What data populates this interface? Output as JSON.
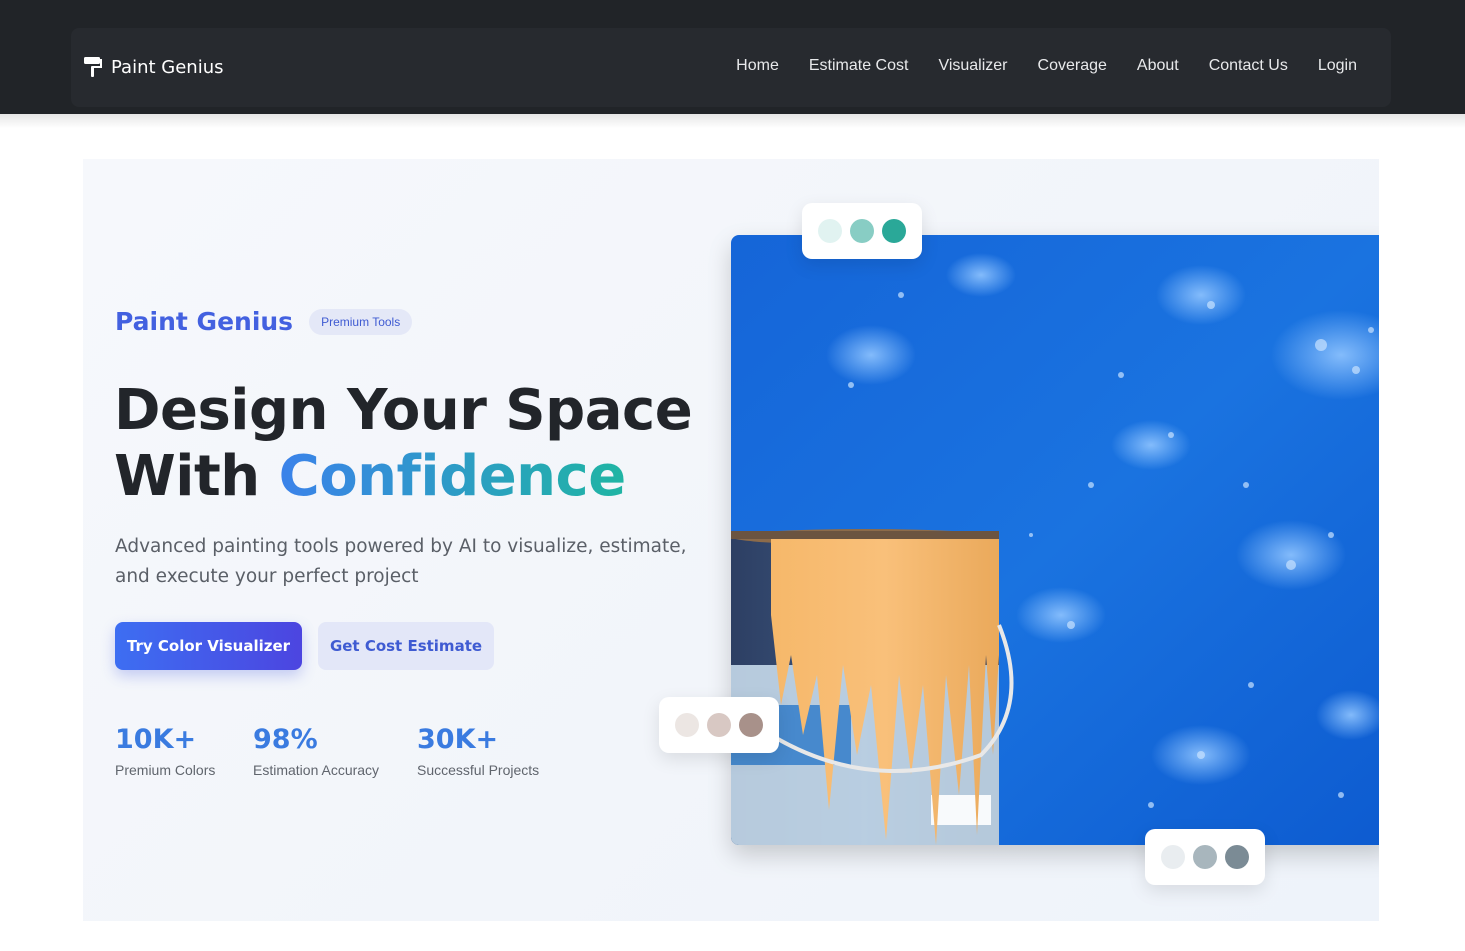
{
  "nav": {
    "brand": "Paint Genius",
    "links": [
      "Home",
      "Estimate Cost",
      "Visualizer",
      "Coverage",
      "About",
      "Contact Us",
      "Login"
    ]
  },
  "hero": {
    "brand": "Paint Genius",
    "badge": "Premium Tools",
    "headline_line1": "Design Your Space",
    "headline_line2_prefix": "With ",
    "headline_line2_highlight": "Confidence",
    "subtitle": "Advanced painting tools powered by AI to visualize, estimate, and execute your perfect project",
    "primary_button": "Try Color Visualizer",
    "secondary_button": "Get Cost Estimate",
    "stats": [
      {
        "value": "10K+",
        "label": "Premium Colors"
      },
      {
        "value": "98%",
        "label": "Estimation Accuracy"
      },
      {
        "value": "30K+",
        "label": "Successful Projects"
      }
    ]
  },
  "palettes": {
    "top": [
      "#e1f3f1",
      "#88cdc4",
      "#2aa898"
    ],
    "middle": [
      "#ece6e3",
      "#d8c8c3",
      "#a8918a"
    ],
    "bottom": [
      "#e9edf0",
      "#a8b6bd",
      "#7b8b95"
    ]
  },
  "colors": {
    "topbar": "#212428",
    "accent": "#4361e0",
    "stat": "#3a7be0"
  },
  "icons": {
    "brand": "paint-roller-icon"
  }
}
